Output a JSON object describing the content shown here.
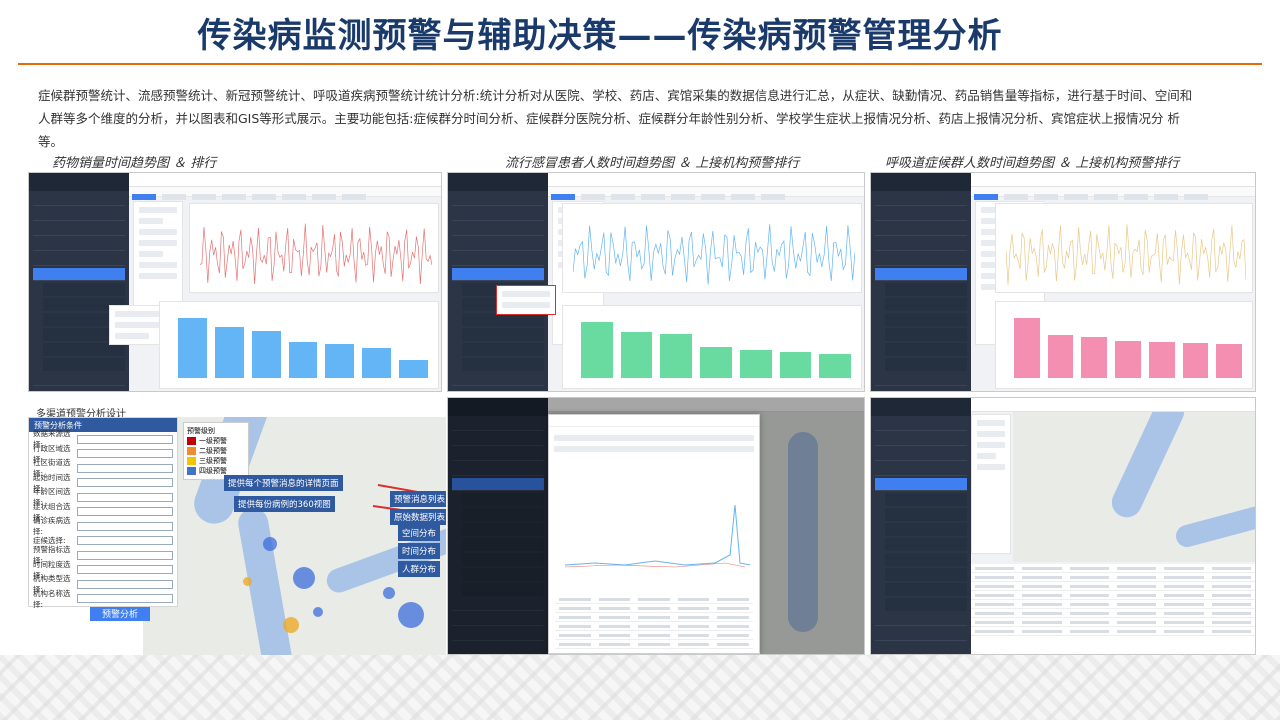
{
  "header": {
    "title": "传染病监测预警与辅助决策——传染病预警管理分析",
    "description": "症候群预警统计、流感预警统计、新冠预警统计、呼吸道疾病预警统计统计分析:统计分析对从医院、学校、药店、宾馆采集的数据信息进行汇总，从症状、缺勤情况、药品销售量等指标，进行基于时间、空间和人群等多个维度的分析，并以图表和GIS等形式展示。主要功能包括:症候群分时间分析、症候群分医院分析、症候群分年龄性别分析、学校学生症状上报情况分析、药店上报情况分析、宾馆症状上报情况分 析等。"
  },
  "captions": {
    "c1": "药物销量时间趋势图 ＆ 排行",
    "c2": "流行感冒患者人数时间趋势图 ＆ 上接机构预警排行",
    "c3": "呼吸道症候群人数时间趋势图 ＆ 上接机构预警排行"
  },
  "map_panel": {
    "heading": "多渠道预警分析设计",
    "form_title": "预警分析条件",
    "fields": [
      "数据来源选择:",
      "行政区域选择:",
      "社区街道选择:",
      "起始时间选择:",
      "年龄区间选择:",
      "症状组合选择:",
      "确诊疾病选择:",
      "症候选择:",
      "预警指标选择:",
      "时间粒度选择:",
      "机构类型选择:",
      "机构名称选择:"
    ],
    "analyze_button": "预警分析",
    "legend_title": "预警级别",
    "legend": [
      {
        "label": "一级预警",
        "color": "#c00000"
      },
      {
        "label": "二级预警",
        "color": "#f28a2e"
      },
      {
        "label": "三级预警",
        "color": "#f5c400"
      },
      {
        "label": "四级预警",
        "color": "#4472c4"
      }
    ],
    "callouts": [
      "提供每个预警消息的详情页面",
      "提供每份病例的360视图"
    ],
    "right_tags": [
      "预警消息列表",
      "原始数据列表",
      "空间分布",
      "时间分布",
      "人群分布"
    ]
  },
  "colors": {
    "title": "#1a3a6b",
    "accent": "#e46c0a",
    "brand_blue": "#3f7ff0"
  },
  "chart_data": [
    {
      "type": "line",
      "series_color": "#e57373"
    },
    {
      "type": "bar",
      "values": [
        100,
        85,
        78,
        60,
        56,
        50,
        30
      ],
      "series_color": "#64b5f6"
    },
    {
      "type": "line",
      "series_color": "#64b5f6"
    },
    {
      "type": "bar",
      "values": [
        100,
        82,
        78,
        55,
        50,
        46,
        42
      ],
      "series_color": "#69dba0"
    },
    {
      "type": "line",
      "series_color": "#e8c98a"
    },
    {
      "type": "bar",
      "values": [
        100,
        72,
        68,
        62,
        60,
        58,
        56
      ],
      "series_color": "#f48fb1"
    }
  ]
}
